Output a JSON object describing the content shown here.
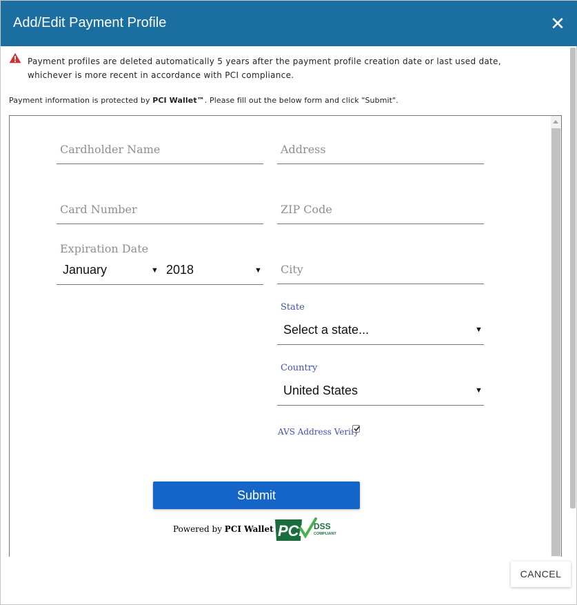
{
  "dialog": {
    "title": "Add/Edit Payment Profile",
    "close_glyph": "✕"
  },
  "warning": {
    "line1": "Payment profiles are deleted automatically 5 years after the payment profile creation date or last used date,",
    "line2": "whichever is more recent in accordance with PCI compliance."
  },
  "info": {
    "prefix": "Payment information is protected by ",
    "brand": "PCI Wallet™",
    "suffix": ". Please fill out the below form and click \"Submit\"."
  },
  "form": {
    "cardholder_name": {
      "placeholder": "Cardholder Name",
      "value": ""
    },
    "address": {
      "placeholder": "Address",
      "value": ""
    },
    "card_number": {
      "placeholder": "Card Number",
      "value": ""
    },
    "zip_code": {
      "placeholder": "ZIP Code",
      "value": ""
    },
    "expiration": {
      "label": "Expiration Date",
      "month": "January",
      "year": "2018"
    },
    "city": {
      "placeholder": "City",
      "value": ""
    },
    "state": {
      "label": "State",
      "value": "Select a state..."
    },
    "country": {
      "label": "Country",
      "value": "United States"
    },
    "avs": {
      "label": "AVS Address Verify",
      "checked": true
    },
    "submit_label": "Submit"
  },
  "footer": {
    "powered_prefix": "Powered by ",
    "powered_brand": "PCI Wallet ™",
    "cancel_label": "CANCEL"
  },
  "logo": {
    "main": "PCI",
    "sub1": "DSS",
    "sub2": "COMPLIANT"
  },
  "colors": {
    "header_bg": "#1a6fa0",
    "submit_bg": "#1565c8",
    "label_accent": "#3f51b5",
    "warning_red": "#d32f2f",
    "logo_green": "#2e8b57"
  },
  "icons": {
    "warning": "warning-triangle-icon",
    "close": "close-icon",
    "dropdown": "caret-down-icon",
    "checkbox": "checkmark-icon"
  }
}
